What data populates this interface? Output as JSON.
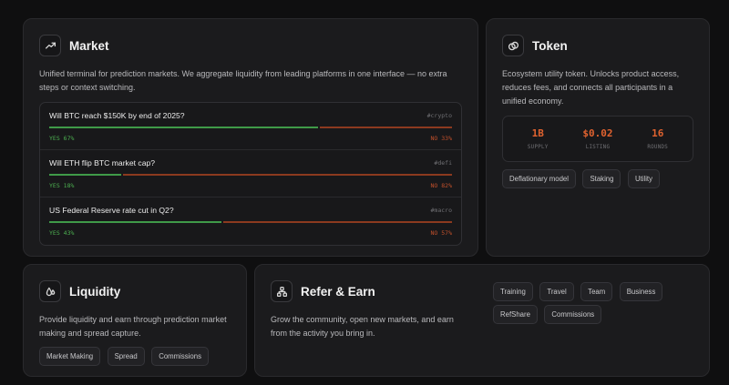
{
  "market": {
    "icon": "trending-up-icon",
    "title": "Market",
    "description": "Unified terminal for prediction markets. We aggregate liquidity from leading platforms in one interface — no extra steps or context switching.",
    "items": [
      {
        "question": "Will BTC reach $150K by end of 2025?",
        "tag": "#crypto",
        "yes_label": "YES 67%",
        "no_label": "NO 33%",
        "yes_pct": 67
      },
      {
        "question": "Will ETH flip BTC market cap?",
        "tag": "#defi",
        "yes_label": "YES 18%",
        "no_label": "NO 82%",
        "yes_pct": 18
      },
      {
        "question": "US Federal Reserve rate cut in Q2?",
        "tag": "#macro",
        "yes_label": "YES 43%",
        "no_label": "NO 57%",
        "yes_pct": 43
      }
    ]
  },
  "token": {
    "icon": "coins-icon",
    "title": "Token",
    "description": "Ecosystem utility token. Unlocks product access, reduces fees, and connects all participants in a unified economy.",
    "stats": [
      {
        "value": "1B",
        "label": "SUPPLY"
      },
      {
        "value": "$0.02",
        "label": "LISTING"
      },
      {
        "value": "16",
        "label": "ROUNDS"
      }
    ],
    "tags": [
      "Deflationary model",
      "Staking",
      "Utility"
    ]
  },
  "liquidity": {
    "icon": "liquidity-icon",
    "title": "Liquidity",
    "description": "Provide liquidity and earn through prediction market making and spread capture.",
    "tags": [
      "Market Making",
      "Spread",
      "Commissions"
    ]
  },
  "refer": {
    "icon": "network-icon",
    "title": "Refer & Earn",
    "description": "Grow the community, open new markets, and earn from the activity you bring in.",
    "tags": [
      "Training",
      "Travel",
      "Team",
      "Business",
      "RefShare",
      "Commissions"
    ]
  },
  "colors": {
    "background": "#0f0f10",
    "card": "#1b1b1d",
    "yes": "#3f9a48",
    "no": "#8c3a1f",
    "accent": "#e0622f"
  }
}
